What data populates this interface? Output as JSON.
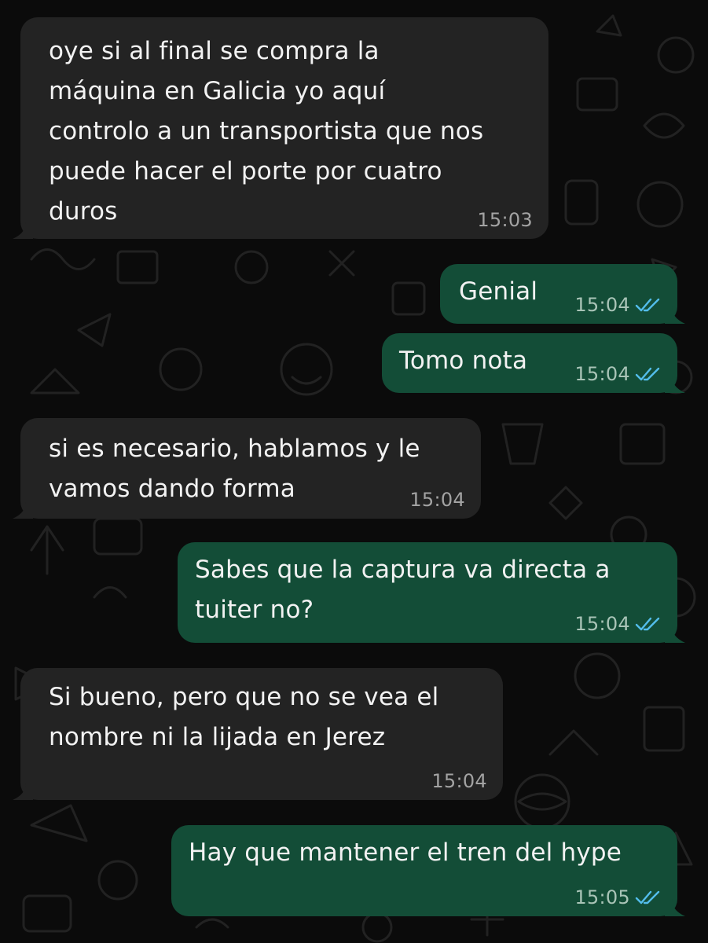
{
  "theme": {
    "background": "#0b0b0b",
    "incoming_bubble": "#232323",
    "outgoing_bubble": "#134d37",
    "read_tick_color": "#53bdeb"
  },
  "messages": [
    {
      "direction": "incoming",
      "text": "oye si al final se compra la\nmáquina en Galicia yo aquí\ncontrolo a un transportista que nos\npuede hacer el porte por cuatro\nduros",
      "time": "15:03"
    },
    {
      "direction": "outgoing",
      "text": "Genial",
      "time": "15:04",
      "status": "read",
      "status_icon": "double-check-icon"
    },
    {
      "direction": "outgoing",
      "text": "Tomo nota",
      "time": "15:04",
      "status": "read",
      "status_icon": "double-check-icon"
    },
    {
      "direction": "incoming",
      "text": "si es necesario, hablamos y le\nvamos dando forma",
      "time": "15:04"
    },
    {
      "direction": "outgoing",
      "text": "Sabes que la captura va directa a\ntuiter no?",
      "time": "15:04",
      "status": "read",
      "status_icon": "double-check-icon"
    },
    {
      "direction": "incoming",
      "text": "Si bueno, pero que no se vea el\nnombre ni la lijada en Jerez",
      "time": "15:04"
    },
    {
      "direction": "outgoing",
      "text": "Hay que mantener el tren del hype",
      "time": "15:05",
      "status": "read",
      "status_icon": "double-check-icon"
    }
  ]
}
